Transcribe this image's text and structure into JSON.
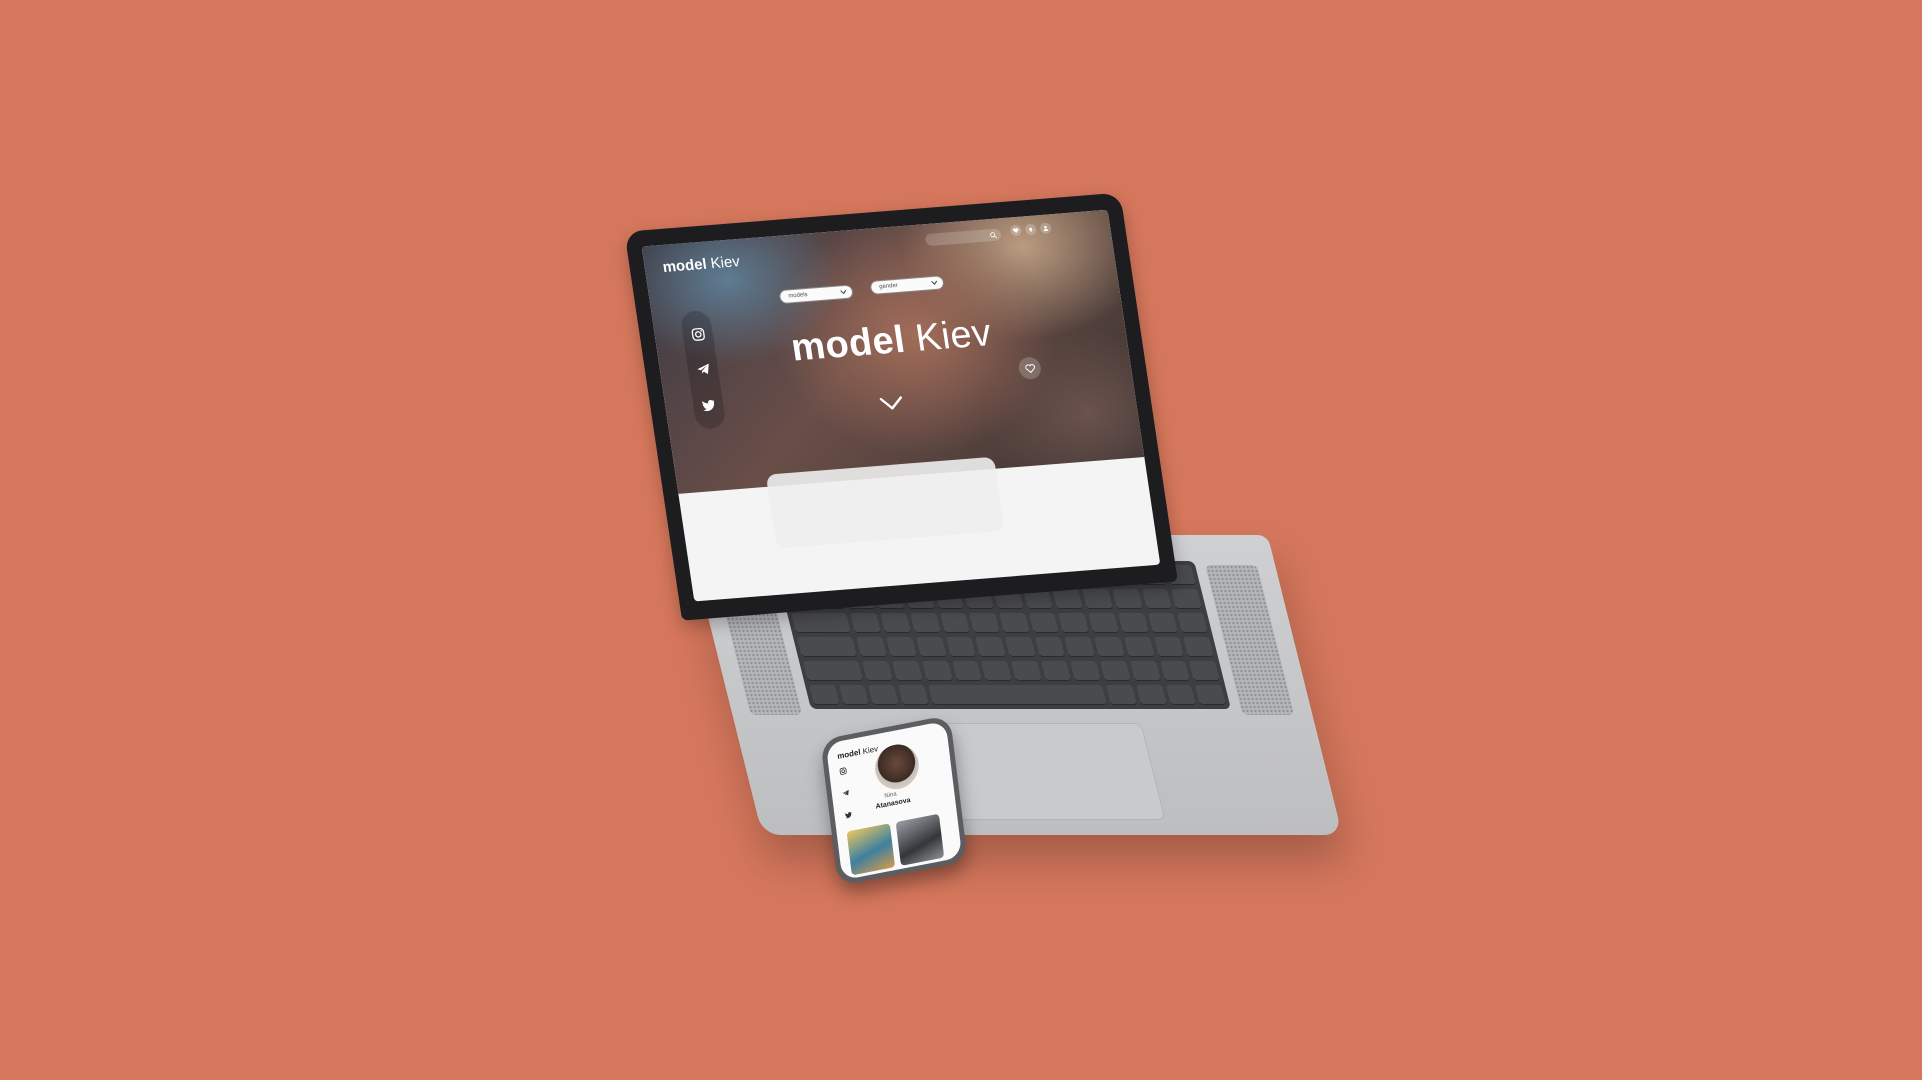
{
  "colors": {
    "background": "#D5775C",
    "laptop_body": "#C6C7C9",
    "keyboard": "#3D3E41",
    "screen_bezel": "#1D1D1F"
  },
  "website": {
    "logo_bold": "model",
    "logo_light": "Kiev",
    "hero_title_bold": "model",
    "hero_title_light": "Kiev",
    "social_icons": [
      "instagram-icon",
      "telegram-icon",
      "twitter-icon"
    ],
    "top_icons": [
      "heart-icon",
      "bell-icon",
      "user-icon"
    ],
    "filters": [
      {
        "label": "models"
      },
      {
        "label": "gender"
      }
    ]
  },
  "phone": {
    "logo_bold": "model",
    "logo_light": "Kiev",
    "name_top": "Nina",
    "name": "Atanasova"
  }
}
